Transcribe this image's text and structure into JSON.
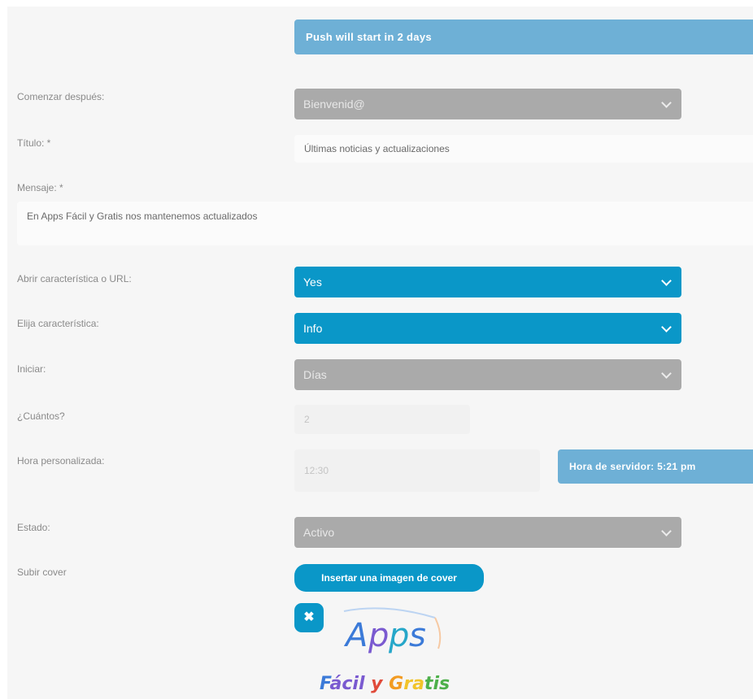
{
  "banner": {
    "text": "Push will start in 2 days"
  },
  "form": {
    "start_after": {
      "label": "Comenzar después:",
      "value": "Bienvenid@"
    },
    "title": {
      "label": "Título: *",
      "value": "Últimas noticias y actualizaciones"
    },
    "message": {
      "label": "Mensaje: *",
      "value": "En Apps Fácil y Gratis nos mantenemos actualizados"
    },
    "open_feature": {
      "label": "Abrir característica o URL:",
      "value": "Yes"
    },
    "choose_feature": {
      "label": "Elija característica:",
      "value": "Info"
    },
    "start": {
      "label": "Iniciar:",
      "value": "Días"
    },
    "how_many": {
      "label": "¿Cuántos?",
      "value": "2"
    },
    "custom_time": {
      "label": "Hora personalizada:",
      "value": "12:30"
    },
    "server_time": {
      "text": "Hora de servidor: 5:21 pm"
    },
    "status": {
      "label": "Estado:",
      "value": "Activo"
    },
    "upload_cover": {
      "label": "Subir cover",
      "button": "Insertar una imagen de cover"
    }
  },
  "icons": {
    "dropdown": "chevron-down-icon",
    "remove": "close-icon"
  },
  "logo": {
    "letters": [
      "A",
      "p",
      "p",
      "s"
    ],
    "tagline_words": [
      "Fácil",
      "y",
      "Gratis"
    ],
    "colors": {
      "blue": "#3b7ad8",
      "violet": "#7a5ad0",
      "teal": "#26a7c9",
      "orange": "#f29b22",
      "red": "#e04b3a",
      "yellow": "#f2c42a",
      "green": "#4db04a"
    }
  },
  "colors": {
    "accent": "#0a97c8",
    "banner": "#6eb0d6",
    "disabled": "#aaaaaa",
    "label": "#8a8a8a"
  }
}
